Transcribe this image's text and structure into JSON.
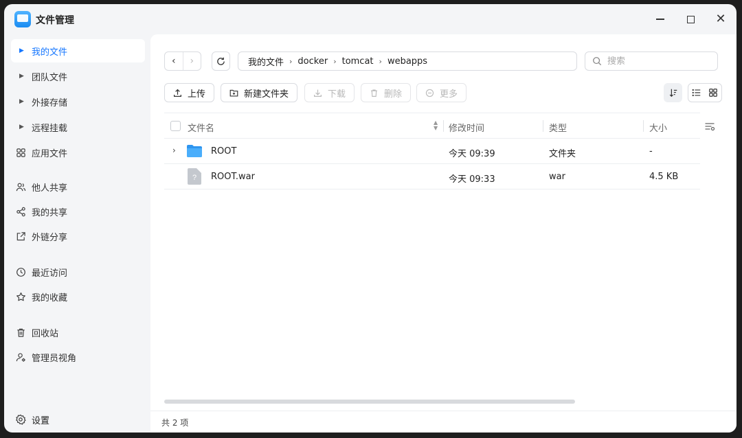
{
  "app": {
    "title": "文件管理"
  },
  "sidebar": {
    "items": [
      {
        "label": "我的文件"
      },
      {
        "label": "团队文件"
      },
      {
        "label": "外接存储"
      },
      {
        "label": "远程挂载"
      },
      {
        "label": "应用文件"
      },
      {
        "label": "他人共享"
      },
      {
        "label": "我的共享"
      },
      {
        "label": "外链分享"
      },
      {
        "label": "最近访问"
      },
      {
        "label": "我的收藏"
      },
      {
        "label": "回收站"
      },
      {
        "label": "管理员视角"
      }
    ],
    "settings_label": "设置",
    "accent": "#1677ff"
  },
  "breadcrumb": [
    "我的文件",
    "docker",
    "tomcat",
    "webapps"
  ],
  "search": {
    "placeholder": "搜索",
    "value": ""
  },
  "toolbar": {
    "upload": "上传",
    "new_folder": "新建文件夹",
    "download": "下载",
    "delete": "删除",
    "more": "更多"
  },
  "table": {
    "headers": {
      "name": "文件名",
      "modified": "修改时间",
      "type": "类型",
      "size": "大小"
    },
    "rows": [
      {
        "name": "ROOT",
        "modified": "今天 09:39",
        "type": "文件夹",
        "size": "-"
      },
      {
        "name": "ROOT.war",
        "modified": "今天 09:33",
        "type": "war",
        "size": "4.5 KB"
      }
    ]
  },
  "status": {
    "count": "共 2 项"
  }
}
